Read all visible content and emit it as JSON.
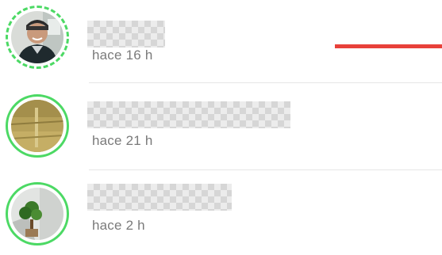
{
  "stories": [
    {
      "timestamp": "hace 16 h",
      "avatar_icon": "person-photo-icon",
      "seen": false
    },
    {
      "timestamp": "hace 21 h",
      "avatar_icon": "field-photo-icon",
      "seen": true
    },
    {
      "timestamp": "hace 2 h",
      "avatar_icon": "plant-photo-icon",
      "seen": true
    }
  ],
  "colors": {
    "ring": "#4cd964",
    "accent": "#e8413a",
    "timestamp": "#7a7a7a"
  }
}
